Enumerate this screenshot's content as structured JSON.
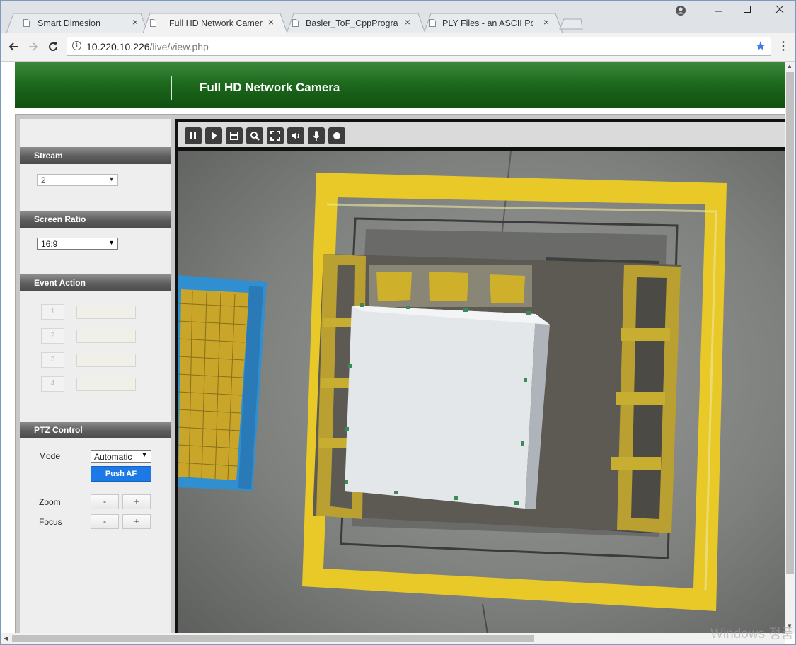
{
  "browser": {
    "tabs": [
      {
        "title": "Smart Dimesion",
        "active": false
      },
      {
        "title": "Full HD Network Camer",
        "active": true
      },
      {
        "title": "Basler_ToF_CppProgram",
        "active": false
      },
      {
        "title": "PLY Files - an ASCII Poly",
        "active": false
      }
    ],
    "url_host": "10.220.10.226",
    "url_path": "/live/view.php",
    "close_glyph": "×"
  },
  "page": {
    "header_title": "Full HD Network Camera"
  },
  "sidebar": {
    "stream": {
      "heading": "Stream",
      "value": "2"
    },
    "screen_ratio": {
      "heading": "Screen Ratio",
      "value": "16:9"
    },
    "event_action": {
      "heading": "Event Action",
      "slots": [
        "1",
        "2",
        "3",
        "4"
      ]
    },
    "ptz": {
      "heading": "PTZ Control",
      "mode_label": "Mode",
      "mode_value": "Automatic",
      "push_af_label": "Push AF",
      "zoom_label": "Zoom",
      "focus_label": "Focus",
      "minus": "-",
      "plus": "+"
    }
  },
  "player": {
    "controls": [
      "pause-icon",
      "play-icon",
      "save-icon",
      "zoom-icon",
      "fullscreen-icon",
      "volume-icon",
      "microphone-icon",
      "record-icon"
    ]
  },
  "os": {
    "watermark": "Windows 정품"
  },
  "colors": {
    "header_green": "#1e6a1e",
    "push_af_blue": "#1c79e6",
    "section_header": "#5d5d5d",
    "floor_tape_yellow": "#e8c928",
    "pallet_blue": "#2f8fd0"
  }
}
